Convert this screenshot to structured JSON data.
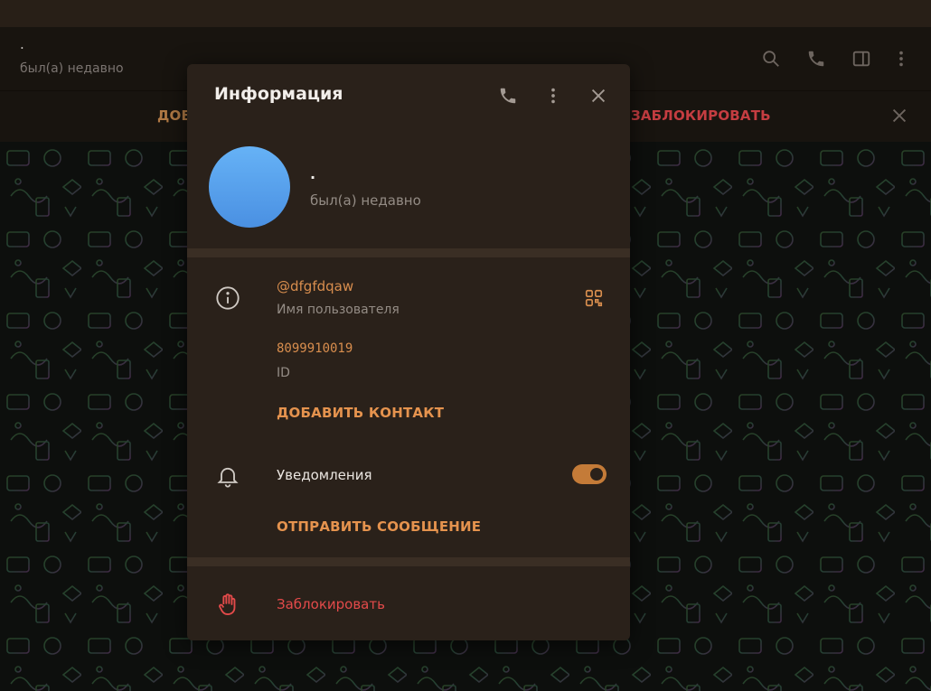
{
  "chat": {
    "title": ".",
    "status": "был(а) недавно"
  },
  "action_bar": {
    "add_label": "ДОБ",
    "block_label": "ЗАБЛОКИРОВАТЬ"
  },
  "modal": {
    "title": "Информация",
    "profile": {
      "name": ".",
      "status": "был(а) недавно"
    },
    "username": {
      "value": "@dfgfdqaw",
      "label": "Имя пользователя"
    },
    "id": {
      "value": "8099910019",
      "label": "ID"
    },
    "add_contact_label": "ДОБАВИТЬ КОНТАКТ",
    "notifications": {
      "label": "Уведомления",
      "enabled": true
    },
    "send_message_label": "ОТПРАВИТЬ СООБЩЕНИЕ",
    "block_label": "Заблокировать"
  },
  "colors": {
    "accent": "#e5934e",
    "danger": "#e34a4a",
    "avatar": "#5aa3ee",
    "modal_bg": "#2a211a"
  },
  "icons": [
    "search-icon",
    "phone-icon",
    "sidebar-icon",
    "more-vertical-icon",
    "close-icon",
    "info-icon",
    "qr-code-icon",
    "bell-icon",
    "hand-block-icon"
  ]
}
